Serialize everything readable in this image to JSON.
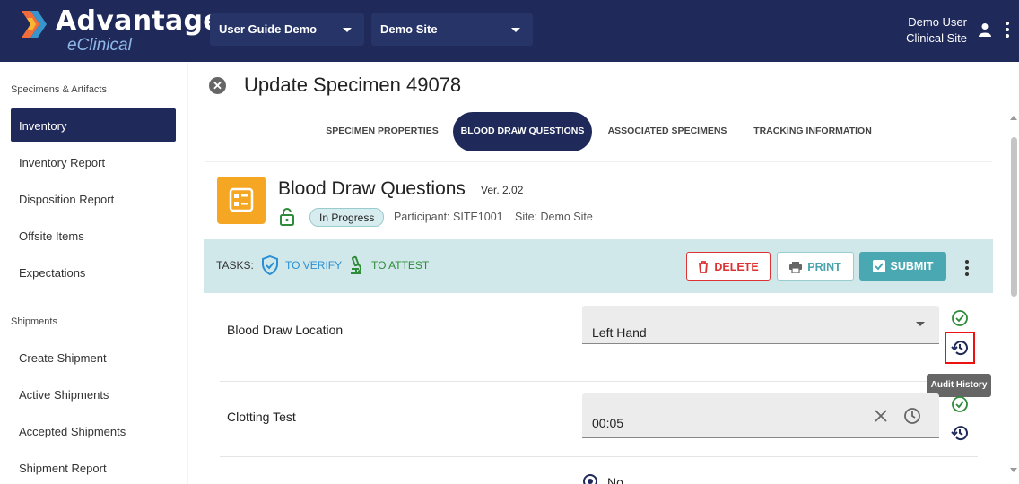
{
  "header": {
    "brand_title": "Advantage",
    "brand_sub": "eClinical",
    "study_select": "User Guide Demo",
    "site_select": "Demo Site",
    "user_name": "Demo User",
    "user_role": "Clinical Site",
    "icons": [
      "logo-icon",
      "chevron-down-icon",
      "person-icon",
      "more-vert-icon"
    ]
  },
  "sidebar": {
    "section1": "Specimens & Artifacts",
    "items1": [
      "Inventory",
      "Inventory Report",
      "Disposition Report",
      "Offsite Items",
      "Expectations"
    ],
    "section2": "Shipments",
    "items2": [
      "Create Shipment",
      "Active Shipments",
      "Accepted Shipments",
      "Shipment Report"
    ],
    "active": "Inventory"
  },
  "page": {
    "title": "Update Specimen 49078",
    "tabs": [
      "SPECIMEN PROPERTIES",
      "BLOOD DRAW QUESTIONS",
      "ASSOCIATED SPECIMENS",
      "TRACKING INFORMATION"
    ],
    "active_tab": "BLOOD DRAW QUESTIONS"
  },
  "form": {
    "title": "Blood Draw Questions",
    "version": "Ver. 2.02",
    "status": "In Progress",
    "participant": "Participant: SITE1001",
    "site": "Site: Demo Site"
  },
  "tasks": {
    "label": "TASKS:",
    "verify": "TO VERIFY",
    "attest": "TO ATTEST",
    "delete_label": "DELETE",
    "print_label": "PRINT",
    "submit_label": "SUBMIT"
  },
  "fields": [
    {
      "label": "Blood Draw Location",
      "value": "Left Hand"
    },
    {
      "label": "Clotting Test",
      "value": "00:05"
    }
  ],
  "radio_partial": "No",
  "tooltip": "Audit History",
  "colors": {
    "navy": "#1f2a5a",
    "orange": "#f5a623",
    "teal": "#4aa8b3",
    "verify_blue": "#2a8fd4",
    "attest_green": "#2e8b3a",
    "delete_red": "#d33333"
  }
}
